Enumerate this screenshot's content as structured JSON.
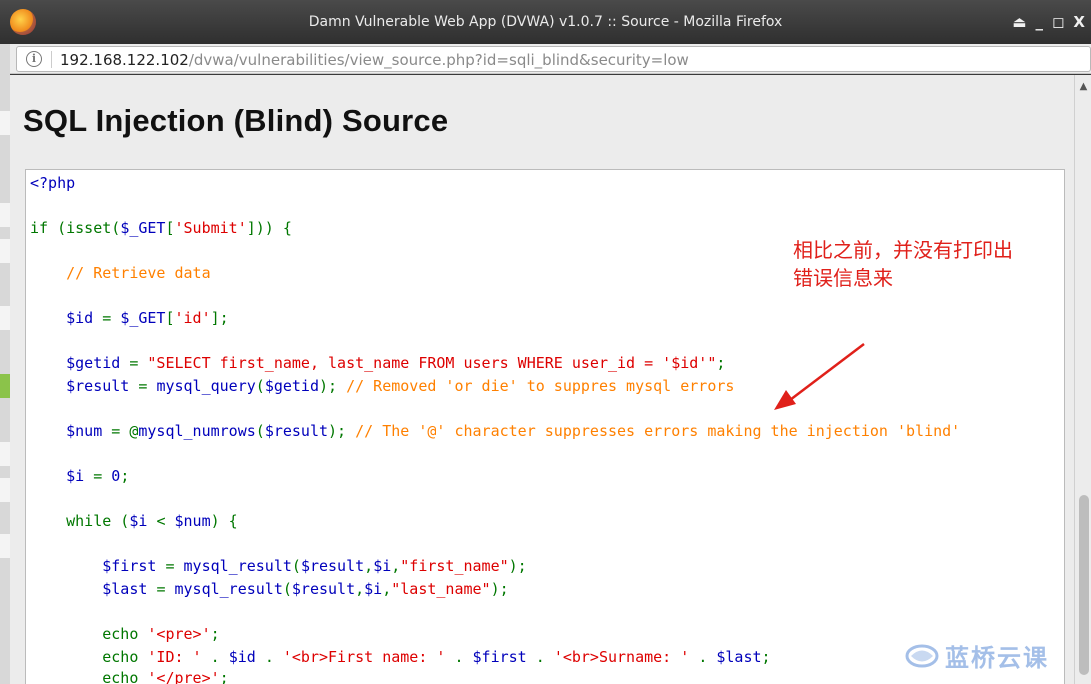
{
  "window": {
    "title": "Damn Vulnerable Web App (DVWA) v1.0.7 :: Source - Mozilla Firefox",
    "controls": [
      "⏏",
      "_",
      "◻",
      "X"
    ]
  },
  "addressbar": {
    "url_host": "192.168.122.102",
    "url_path": "/dvwa/vulnerabilities/view_source.php?id=sqli_blind&security=low"
  },
  "page": {
    "title": "SQL Injection (Blind) Source"
  },
  "code": [
    {
      "segments": [
        {
          "t": "<?php",
          "c": "def"
        }
      ]
    },
    {
      "segments": [
        {
          "t": "if (isset(",
          "c": "kw"
        },
        {
          "t": "$_GET",
          "c": "def"
        },
        {
          "t": "[",
          "c": "kw"
        },
        {
          "t": "'Submit'",
          "c": "str"
        },
        {
          "t": "])) {",
          "c": "kw"
        }
      ]
    },
    {
      "segments": [
        {
          "t": "    // Retrieve data",
          "c": "cm"
        }
      ]
    },
    {
      "segments": [
        {
          "t": "    $id ",
          "c": "def"
        },
        {
          "t": "= ",
          "c": "kw"
        },
        {
          "t": "$_GET",
          "c": "def"
        },
        {
          "t": "[",
          "c": "kw"
        },
        {
          "t": "'id'",
          "c": "str"
        },
        {
          "t": "];",
          "c": "kw"
        }
      ]
    },
    {
      "segments": [
        {
          "t": "    $getid ",
          "c": "def"
        },
        {
          "t": "= ",
          "c": "kw"
        },
        {
          "t": "\"SELECT first_name, last_name FROM users WHERE user_id = '$id'\"",
          "c": "str"
        },
        {
          "t": ";",
          "c": "kw"
        }
      ]
    },
    {
      "segments": [
        {
          "t": "    $result ",
          "c": "def"
        },
        {
          "t": "= ",
          "c": "kw"
        },
        {
          "t": "mysql_query",
          "c": "def"
        },
        {
          "t": "(",
          "c": "kw"
        },
        {
          "t": "$getid",
          "c": "def"
        },
        {
          "t": "); ",
          "c": "kw"
        },
        {
          "t": "// Removed 'or die' to suppres mysql errors",
          "c": "cm"
        }
      ]
    },
    {
      "segments": [
        {
          "t": "    $num ",
          "c": "def"
        },
        {
          "t": "= @",
          "c": "kw"
        },
        {
          "t": "mysql_numrows",
          "c": "def"
        },
        {
          "t": "(",
          "c": "kw"
        },
        {
          "t": "$result",
          "c": "def"
        },
        {
          "t": "); ",
          "c": "kw"
        },
        {
          "t": "// The '@' character suppresses errors making the injection 'blind'",
          "c": "cm"
        }
      ]
    },
    {
      "segments": [
        {
          "t": "    $i ",
          "c": "def"
        },
        {
          "t": "= ",
          "c": "kw"
        },
        {
          "t": "0",
          "c": "def"
        },
        {
          "t": ";",
          "c": "kw"
        }
      ]
    },
    {
      "segments": [
        {
          "t": "    while (",
          "c": "kw"
        },
        {
          "t": "$i ",
          "c": "def"
        },
        {
          "t": "< ",
          "c": "kw"
        },
        {
          "t": "$num",
          "c": "def"
        },
        {
          "t": ") {",
          "c": "kw"
        }
      ]
    },
    {
      "segments": [
        {
          "t": "        $first ",
          "c": "def"
        },
        {
          "t": "= ",
          "c": "kw"
        },
        {
          "t": "mysql_result",
          "c": "def"
        },
        {
          "t": "(",
          "c": "kw"
        },
        {
          "t": "$result",
          "c": "def"
        },
        {
          "t": ",",
          "c": "kw"
        },
        {
          "t": "$i",
          "c": "def"
        },
        {
          "t": ",",
          "c": "kw"
        },
        {
          "t": "\"first_name\"",
          "c": "str"
        },
        {
          "t": ");",
          "c": "kw"
        }
      ]
    },
    {
      "segments": [
        {
          "t": "        $last ",
          "c": "def"
        },
        {
          "t": "= ",
          "c": "kw"
        },
        {
          "t": "mysql_result",
          "c": "def"
        },
        {
          "t": "(",
          "c": "kw"
        },
        {
          "t": "$result",
          "c": "def"
        },
        {
          "t": ",",
          "c": "kw"
        },
        {
          "t": "$i",
          "c": "def"
        },
        {
          "t": ",",
          "c": "kw"
        },
        {
          "t": "\"last_name\"",
          "c": "str"
        },
        {
          "t": ");",
          "c": "kw"
        }
      ]
    },
    {
      "segments": [
        {
          "t": "        echo ",
          "c": "kw"
        },
        {
          "t": "'<pre>'",
          "c": "str"
        },
        {
          "t": ";",
          "c": "kw"
        }
      ]
    },
    {
      "segments": [
        {
          "t": "        echo ",
          "c": "kw"
        },
        {
          "t": "'ID: ' ",
          "c": "str"
        },
        {
          "t": ". ",
          "c": "kw"
        },
        {
          "t": "$id ",
          "c": "def"
        },
        {
          "t": ". ",
          "c": "kw"
        },
        {
          "t": "'<br>First name: ' ",
          "c": "str"
        },
        {
          "t": ". ",
          "c": "kw"
        },
        {
          "t": "$first ",
          "c": "def"
        },
        {
          "t": ". ",
          "c": "kw"
        },
        {
          "t": "'<br>Surname: ' ",
          "c": "str"
        },
        {
          "t": ". ",
          "c": "kw"
        },
        {
          "t": "$last",
          "c": "def"
        },
        {
          "t": ";",
          "c": "kw"
        }
      ]
    },
    {
      "segments": [
        {
          "t": "        echo ",
          "c": "kw"
        },
        {
          "t": "'</pre>'",
          "c": "str"
        },
        {
          "t": ";",
          "c": "kw"
        }
      ]
    }
  ],
  "code_colors": {
    "kw": "#007700",
    "str": "#dd0000",
    "cm": "#ff8000",
    "def": "#0000bb"
  },
  "annotation": {
    "line1": "相比之前，并没有打印出",
    "line2": "错误信息来",
    "color": "#e0201a"
  },
  "watermark": {
    "text": "蓝桥云课",
    "icon": "lanqiao-logo-icon"
  }
}
